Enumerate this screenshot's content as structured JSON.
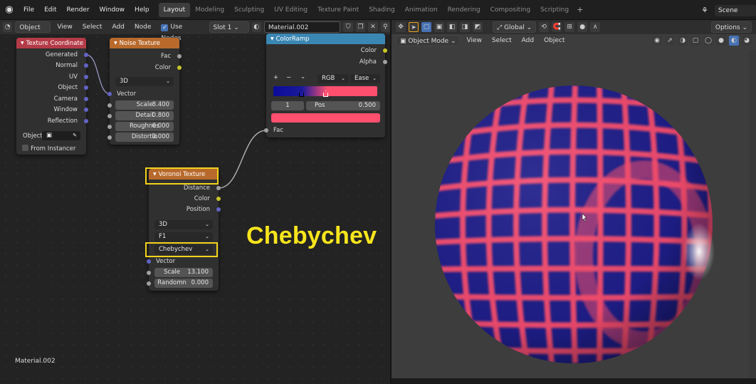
{
  "topbar": {
    "menus": [
      "File",
      "Edit",
      "Render",
      "Window",
      "Help"
    ],
    "workspaces": [
      "Layout",
      "Modeling",
      "Sculpting",
      "UV Editing",
      "Texture Paint",
      "Shading",
      "Animation",
      "Rendering",
      "Compositing",
      "Scripting"
    ],
    "active_workspace": "Layout",
    "add_workspace": "+",
    "scene": "Scene"
  },
  "node_editor": {
    "header": {
      "object_mode": "Object",
      "menus": [
        "View",
        "Select",
        "Add",
        "Node"
      ],
      "use_nodes": "Use Nodes",
      "slot": "Slot 1",
      "material": "Material.002"
    },
    "material_label": "Material.002",
    "texture_coordinate": {
      "title": "Texture Coordinate",
      "outputs": [
        "Generated",
        "Normal",
        "UV",
        "Object",
        "Camera",
        "Window",
        "Reflection"
      ],
      "object_label": "Object",
      "from_instancer": "From Instancer"
    },
    "noise_texture": {
      "title": "Noise Texture",
      "outputs": [
        "Fac",
        "Color"
      ],
      "dimension": "3D",
      "vector": "Vector",
      "fields": [
        {
          "label": "Scale",
          "value": "8.400"
        },
        {
          "label": "Detail",
          "value": "0.800"
        },
        {
          "label": "Roughnes",
          "value": "0.000"
        },
        {
          "label": "Distortio",
          "value": "0.000"
        }
      ]
    },
    "color_ramp": {
      "title": "ColorRamp",
      "outputs": [
        "Color",
        "Alpha"
      ],
      "controls": {
        "add": "+",
        "remove": "−",
        "menu": "⌄",
        "mode": "RGB",
        "interp": "Ease"
      },
      "stop_index": "1",
      "pos_label": "Pos",
      "pos_value": "0.500",
      "fac": "Fac",
      "stop_color": "#ff4f6e"
    },
    "voronoi_texture": {
      "title": "Voronoi Texture",
      "outputs": [
        "Distance",
        "Color",
        "Position"
      ],
      "dimension": "3D",
      "feature": "F1",
      "metric": "Chebychev",
      "vector": "Vector",
      "fields": [
        {
          "label": "Scale",
          "value": "13.100"
        },
        {
          "label": "Randomn",
          "value": "0.000"
        }
      ]
    },
    "annotation": "Chebychev"
  },
  "viewport": {
    "header": {
      "orientation": "Global",
      "options": "Options"
    },
    "sub": {
      "mode": "Object Mode",
      "menus": [
        "View",
        "Select",
        "Add",
        "Object"
      ]
    }
  },
  "colors": {
    "accent": "#4772b3",
    "highlight": "#f2d21b",
    "sphere_blue": "#1e1e8a",
    "sphere_pink": "#ff4f6e",
    "tex_coord_header": "#b33b47",
    "texture_header": "#b86a2c",
    "converter_header": "#3b87b3"
  }
}
